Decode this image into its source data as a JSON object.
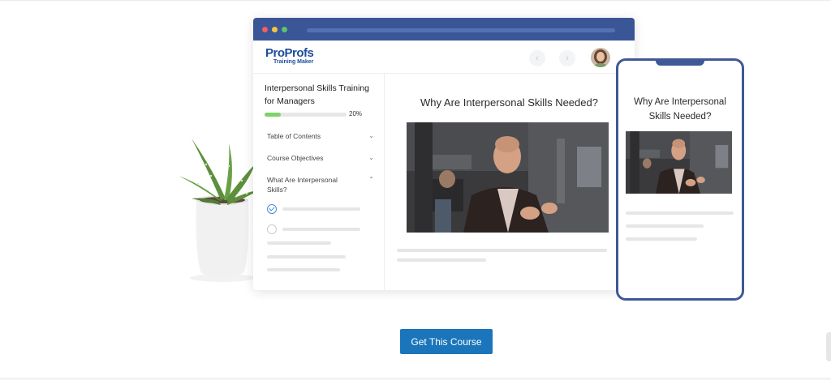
{
  "logo": {
    "pro": "Pro",
    "profs": "Profs",
    "sub": "Training Maker"
  },
  "nav": {
    "prev_icon": "chevron-left-icon",
    "next_icon": "chevron-right-icon"
  },
  "sidebar": {
    "course_title": "Interpersonal Skills Training for Managers",
    "progress": {
      "value": 0.2,
      "label": "20%"
    },
    "items": [
      {
        "label": "Table of Contents",
        "icon": "chevron-down-icon",
        "glyph": "⌄"
      },
      {
        "label": "Course Objectives",
        "icon": "chevron-down-icon",
        "glyph": "⌄"
      },
      {
        "label": "What Are Interpersonal Skills?",
        "icon": "chevron-up-icon",
        "glyph": "⌃"
      }
    ]
  },
  "main": {
    "title": "Why Are Interpersonal Skills Needed?"
  },
  "phone": {
    "title": "Why Are Interpersonal Skills Needed?"
  },
  "cta": {
    "label": "Get This Course"
  },
  "colors": {
    "titlebar": "#3a5696",
    "progress": "#7ed36a",
    "cta": "#1b75bb",
    "phone_border": "#3f5896"
  }
}
